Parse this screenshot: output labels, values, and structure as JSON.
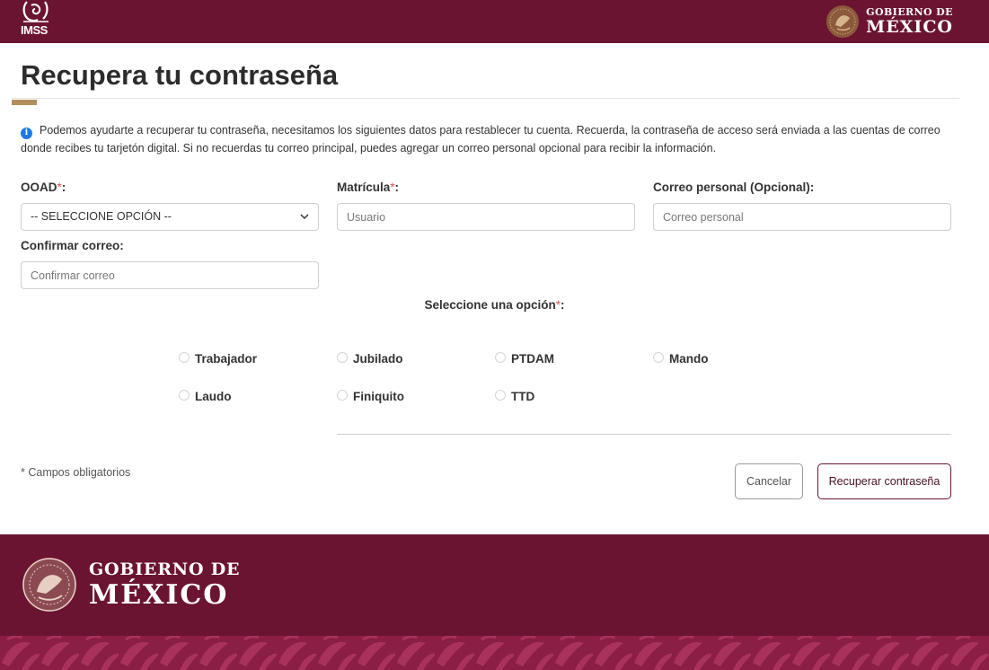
{
  "header": {
    "logo_text": "IMSS",
    "gov_line1": "GOBIERNO DE",
    "gov_line2": "MÉXICO"
  },
  "page": {
    "title": "Recupera tu contraseña",
    "info": "Podemos ayudarte a recuperar tu contraseña, necesitamos los siguientes datos para restablecer tu cuenta. Recuerda, la contraseña de acceso será enviada a las cuentas de correo donde recibes tu tarjetón digital. Si no recuerdas tu correo principal, puedes agregar un correo personal opcional para recibir la información."
  },
  "form": {
    "ooad_label": "OOAD",
    "ooad_selected": "-- SELECCIONE OPCIÓN --",
    "matricula_label": "Matrícula",
    "matricula_placeholder": "Usuario",
    "correo_label": "Correo personal (Opcional):",
    "correo_placeholder": "Correo personal",
    "confirmar_label": "Confirmar correo:",
    "confirmar_placeholder": "Confirmar correo",
    "required_mark": "*",
    "colon": ":",
    "option_title": "Seleccione una opción",
    "options": [
      "Trabajador",
      "Jubilado",
      "PTDAM",
      "Mando",
      "Laudo",
      "Finiquito",
      "TTD"
    ],
    "required_note": "* Campos obligatorios",
    "cancel_label": "Cancelar",
    "submit_label": "Recuperar contraseña"
  },
  "footer": {
    "gov_line1": "GOBIERNO DE",
    "gov_line2": "MÉXICO"
  },
  "colors": {
    "brand": "#6b1432",
    "gold": "#b38e5d",
    "info": "#1e7be0"
  },
  "icons": {
    "imss": "imss-logo-icon",
    "seal": "mexico-seal-icon",
    "info": "info-icon",
    "chevron": "chevron-down-icon"
  }
}
